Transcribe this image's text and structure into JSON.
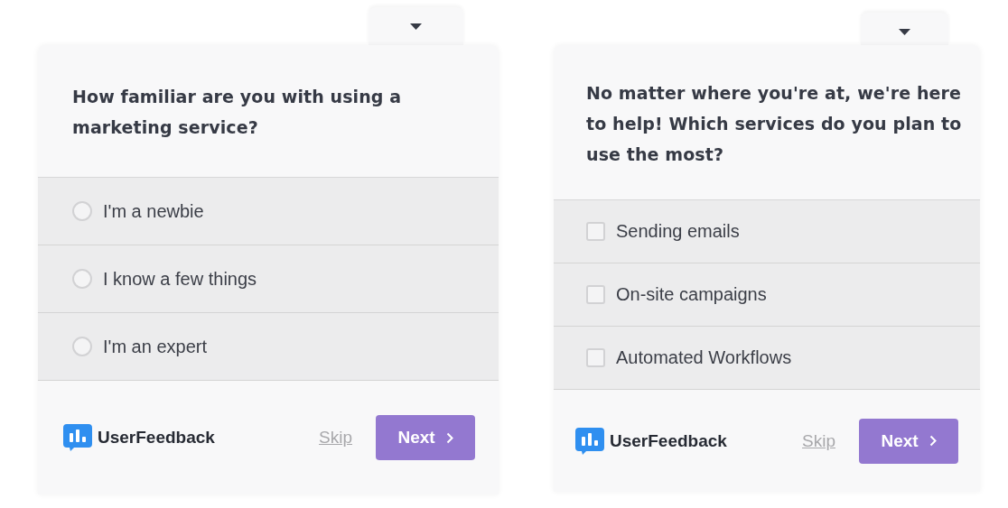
{
  "surveys": [
    {
      "question": "How familiar are you with using a marketing service?",
      "options": [
        {
          "kind": "radio",
          "label": "I'm a newbie",
          "selected": false
        },
        {
          "kind": "radio",
          "label": "I know a few things",
          "selected": false
        },
        {
          "kind": "radio",
          "label": "I'm an expert",
          "selected": false
        }
      ],
      "brand": "UserFeedback",
      "skip": "Skip",
      "next": "Next"
    },
    {
      "question": "No matter where you're at, we're here to help! Which services do you plan to use the most?",
      "options": [
        {
          "kind": "checkbox",
          "label": "Sending emails",
          "selected": false
        },
        {
          "kind": "checkbox",
          "label": "On-site campaigns",
          "selected": false
        },
        {
          "kind": "checkbox",
          "label": "Automated Workflows",
          "selected": false
        }
      ],
      "brand": "UserFeedback",
      "skip": "Skip",
      "next": "Next"
    }
  ]
}
